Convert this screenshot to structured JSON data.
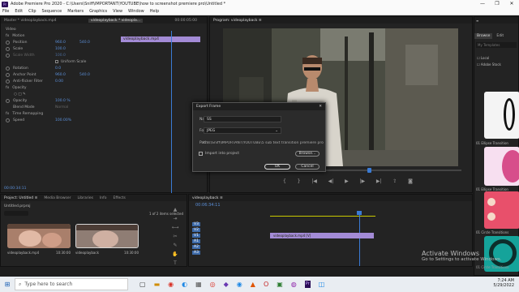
{
  "window": {
    "title": "Adobe Premiere Pro 2020 - C:\\Users\\Sniff\\IMPORTANT\\YOUTUBE\\how to screenshot premiere pro\\Untitled *",
    "logo": "Pr",
    "controls": [
      "—",
      "❐",
      "✕"
    ]
  },
  "menu": [
    "File",
    "Edit",
    "Clip",
    "Sequence",
    "Markers",
    "Graphics",
    "View",
    "Window",
    "Help"
  ],
  "effects_panel": {
    "source": "Master * videoplayback.mp4",
    "sequence": "videoplayback * videopla...",
    "time": "00:00:05:00",
    "clip_label": "videoplayback.mp4",
    "section_video": "Video",
    "motion": "Motion",
    "props": [
      {
        "name": "Position",
        "v1": "960.0",
        "v2": "540.0"
      },
      {
        "name": "Scale",
        "v1": "100.0",
        "v2": ""
      },
      {
        "name": "Scale Width",
        "v1": "100.0",
        "v2": ""
      },
      {
        "name": "Uniform Scale",
        "v1": "",
        "v2": ""
      },
      {
        "name": "Rotation",
        "v1": "0.0",
        "v2": ""
      },
      {
        "name": "Anchor Point",
        "v1": "960.0",
        "v2": "540.0"
      },
      {
        "name": "Anti-flicker Filter",
        "v1": "0.00",
        "v2": ""
      }
    ],
    "opacity": "Opacity",
    "opacity_props": [
      {
        "name": "Opacity",
        "v1": "100.0 %"
      },
      {
        "name": "Blend Mode",
        "v1": "Normal"
      }
    ],
    "time_remap": "Time Remapping",
    "speed_label": "Speed",
    "speed_value": "100.00%",
    "footer_time": "00:00:34:11"
  },
  "program_panel": {
    "title": "Program: videoplayback ≡",
    "timecode": "00:00:30:03"
  },
  "dialog": {
    "title": "Export Frame",
    "name_label": "Name:",
    "name_value": "SS",
    "format_label": "Format:",
    "format_value": "JPEG",
    "path_label": "Path:",
    "path_value": "C:\\s\\Sniff\\IMPORTANT\\YOUTUBE\\5 sub text transition premiere pro",
    "import_label": "Import into project",
    "browse": "Browse...",
    "ok": "OK",
    "cancel": "Cancel"
  },
  "project_panel": {
    "tabs": [
      "Project: Untitled ≡",
      "Media Browser",
      "Libraries",
      "Info",
      "Effects"
    ],
    "project_file": "Untitled.prproj",
    "selection": "1 of 2 items selected",
    "items": [
      {
        "name": "videoplayback.mp4",
        "duration": "10:30:00"
      },
      {
        "name": "videoplayback",
        "duration": "10:30:00"
      }
    ]
  },
  "timeline_panel": {
    "tab": "videoplayback ≡",
    "timecode": "00:06:34:11",
    "tracks_video": [
      "V3",
      "V2",
      "V1"
    ],
    "tracks_audio": [
      "A1",
      "A2",
      "A3"
    ],
    "clip": "videoplayback.mp4 [V]"
  },
  "right_panel": {
    "tabs": [
      "Browse",
      "Edit"
    ],
    "search_placeholder": "My Templates",
    "checkboxes": [
      "Local",
      "Adobe Stock"
    ],
    "templates": [
      "01 Ellipse Transition",
      "01 Ellipse Transition",
      "01 Circle Transitions",
      "01 Circle Transitions"
    ]
  },
  "taskbar": {
    "search_placeholder": "Type here to search",
    "time": "7:24 AM",
    "date": "5/29/2022",
    "activate_title": "Activate Windows",
    "activate_sub": "Go to Settings to activate Windows."
  }
}
